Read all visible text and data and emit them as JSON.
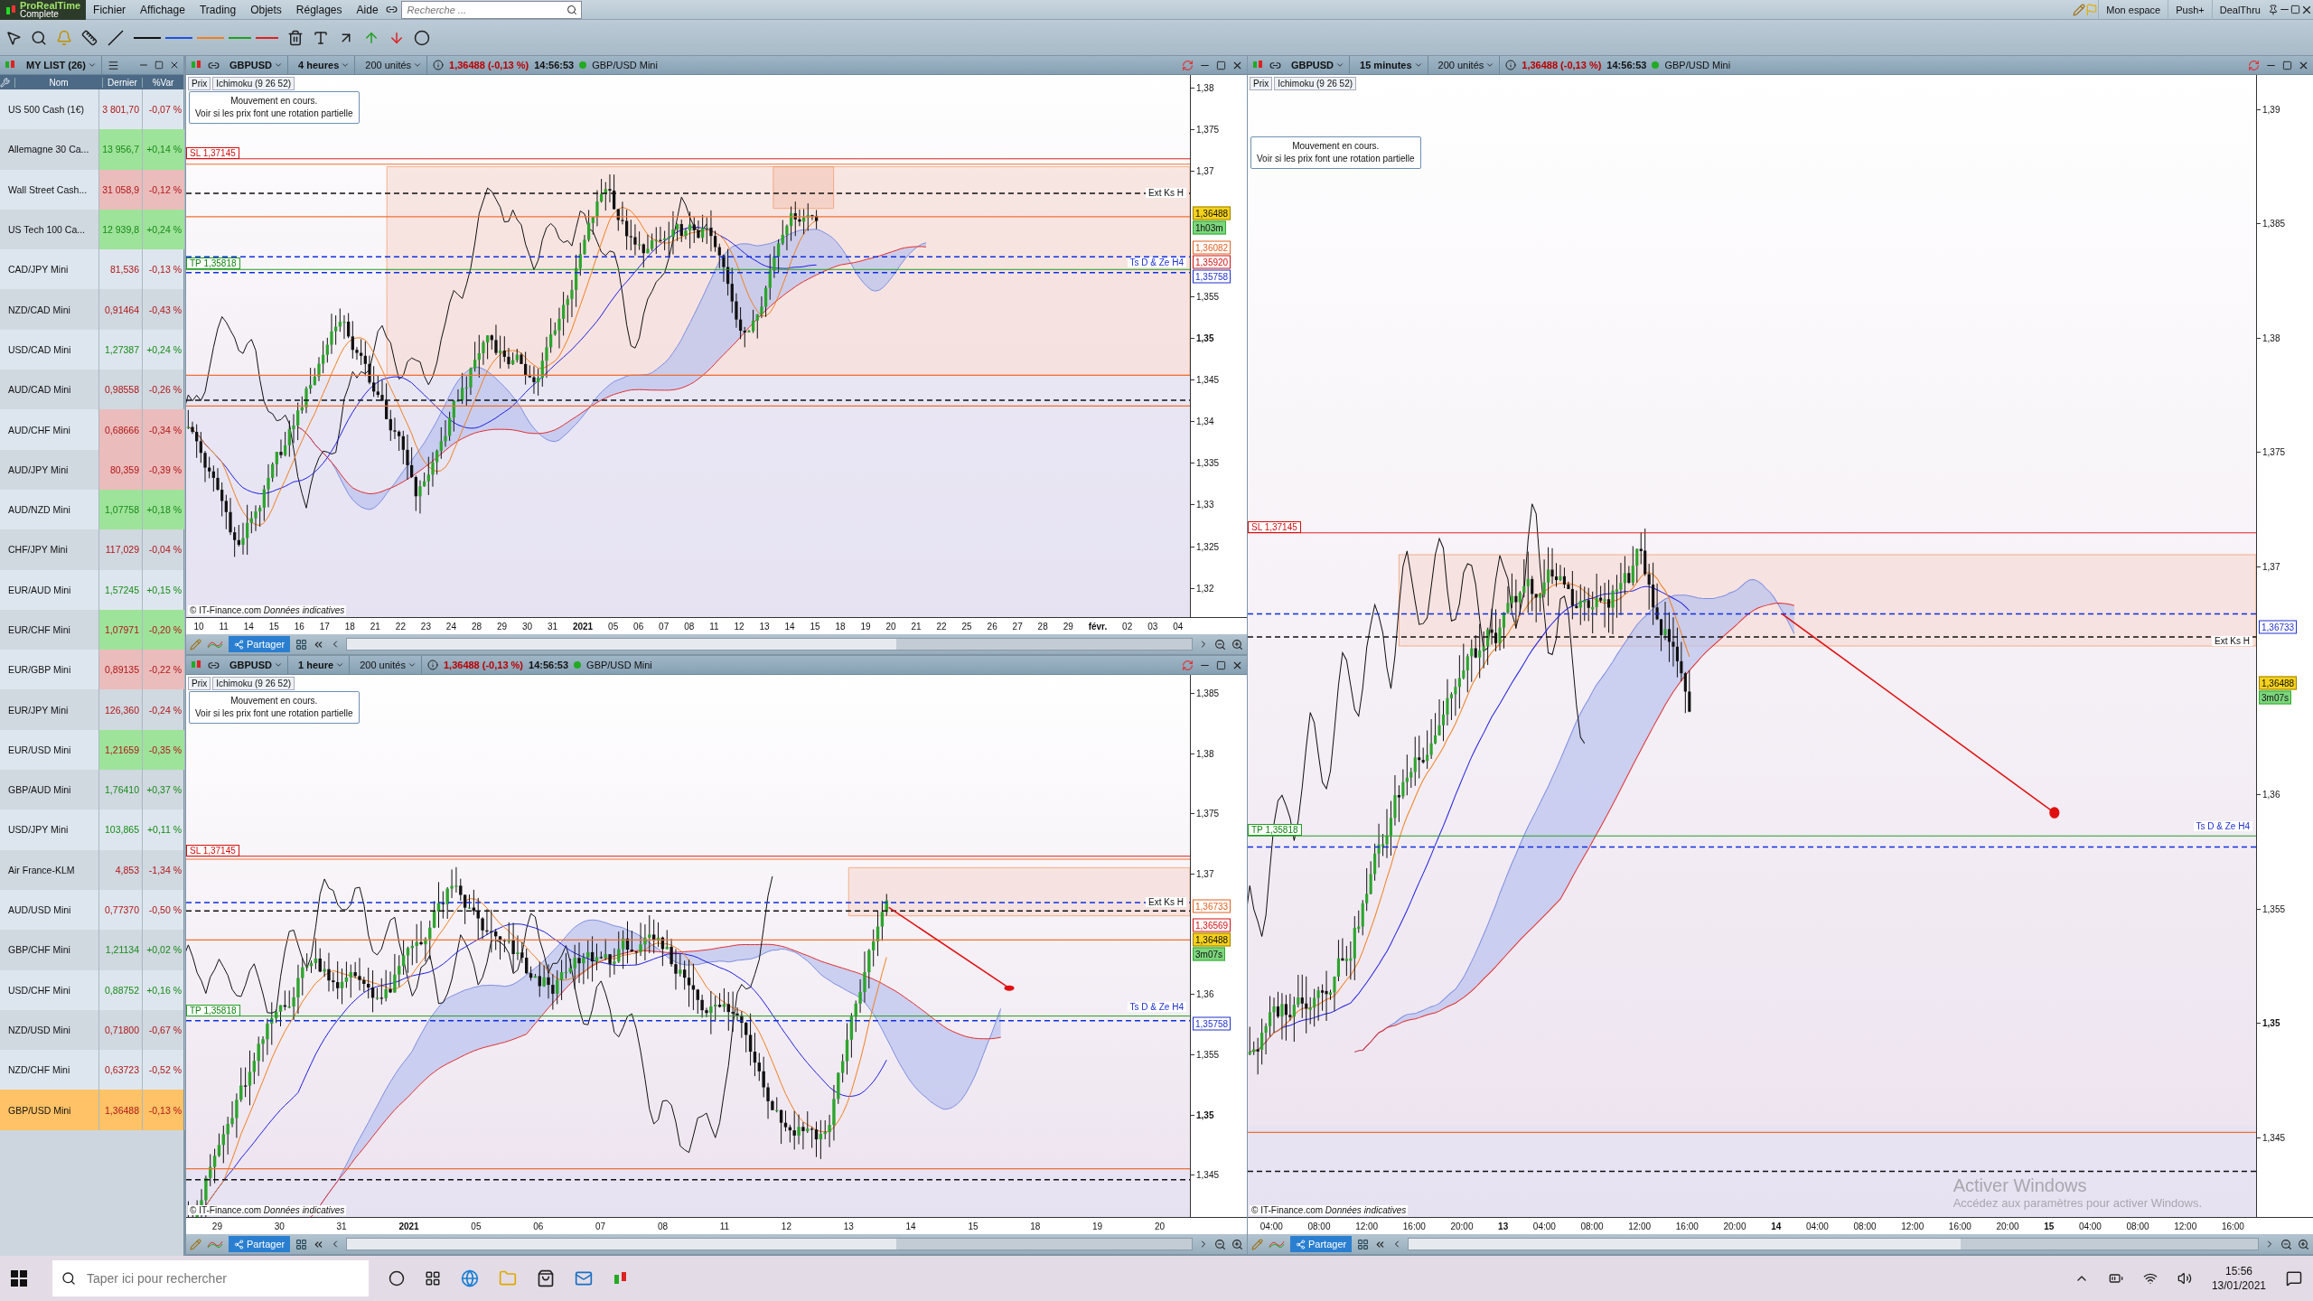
{
  "app": {
    "brand": "ProRealTime",
    "edition": "Complete"
  },
  "menu": [
    "Fichier",
    "Affichage",
    "Trading",
    "Objets",
    "Réglages",
    "Aide"
  ],
  "search": {
    "placeholder": "Recherche ..."
  },
  "top_right": [
    "Mon espace",
    "Push+",
    "DealThru"
  ],
  "watchlist": {
    "title": "MY LIST (26)",
    "columns": [
      "Nom",
      "Dernier",
      "%Var"
    ],
    "rows": [
      {
        "name": "US 500 Cash (1€)",
        "last": "3 801,70",
        "change": "-0,07 %",
        "rising": false,
        "flash_up": false,
        "flash_down": false,
        "selected": false
      },
      {
        "name": "Allemagne 30 Ca...",
        "last": "13 956,7",
        "change": "+0,14 %",
        "rising": true,
        "flash_up": true,
        "flash_down": false,
        "selected": false
      },
      {
        "name": "Wall Street Cash...",
        "last": "31 058,9",
        "change": "-0,12 %",
        "rising": false,
        "flash_up": false,
        "flash_down": true,
        "selected": false
      },
      {
        "name": "US Tech 100 Ca...",
        "last": "12 939,8",
        "change": "+0,24 %",
        "rising": true,
        "flash_up": true,
        "flash_down": false,
        "selected": false
      },
      {
        "name": "CAD/JPY Mini",
        "last": "81,536",
        "change": "-0,13 %",
        "rising": false,
        "flash_up": false,
        "flash_down": false,
        "selected": false
      },
      {
        "name": "NZD/CAD Mini",
        "last": "0,91464",
        "change": "-0,43 %",
        "rising": false,
        "flash_up": false,
        "flash_down": false,
        "selected": false
      },
      {
        "name": "USD/CAD Mini",
        "last": "1,27387",
        "change": "+0,24 %",
        "rising": true,
        "flash_up": false,
        "flash_down": false,
        "selected": false
      },
      {
        "name": "AUD/CAD Mini",
        "last": "0,98558",
        "change": "-0,26 %",
        "rising": false,
        "flash_up": false,
        "flash_down": false,
        "selected": false
      },
      {
        "name": "AUD/CHF Mini",
        "last": "0,68666",
        "change": "-0,34 %",
        "rising": false,
        "flash_up": false,
        "flash_down": true,
        "selected": false
      },
      {
        "name": "AUD/JPY Mini",
        "last": "80,359",
        "change": "-0,39 %",
        "rising": false,
        "flash_up": false,
        "flash_down": true,
        "selected": false
      },
      {
        "name": "AUD/NZD Mini",
        "last": "1,07758",
        "change": "+0,18 %",
        "rising": true,
        "flash_up": true,
        "flash_down": false,
        "selected": false
      },
      {
        "name": "CHF/JPY Mini",
        "last": "117,029",
        "change": "-0,04 %",
        "rising": false,
        "flash_up": false,
        "flash_down": false,
        "selected": false
      },
      {
        "name": "EUR/AUD Mini",
        "last": "1,57245",
        "change": "+0,15 %",
        "rising": true,
        "flash_up": false,
        "flash_down": false,
        "selected": false
      },
      {
        "name": "EUR/CHF Mini",
        "last": "1,07971",
        "change": "-0,20 %",
        "rising": false,
        "flash_up": true,
        "flash_down": false,
        "selected": false
      },
      {
        "name": "EUR/GBP Mini",
        "last": "0,89135",
        "change": "-0,22 %",
        "rising": false,
        "flash_up": false,
        "flash_down": true,
        "selected": false
      },
      {
        "name": "EUR/JPY Mini",
        "last": "126,360",
        "change": "-0,24 %",
        "rising": false,
        "flash_up": false,
        "flash_down": false,
        "selected": false
      },
      {
        "name": "EUR/USD Mini",
        "last": "1,21659",
        "change": "-0,35 %",
        "rising": false,
        "flash_up": true,
        "flash_down": false,
        "selected": false
      },
      {
        "name": "GBP/AUD Mini",
        "last": "1,76410",
        "change": "+0,37 %",
        "rising": true,
        "flash_up": false,
        "flash_down": false,
        "selected": false
      },
      {
        "name": "USD/JPY Mini",
        "last": "103,865",
        "change": "+0,11 %",
        "rising": true,
        "flash_up": false,
        "flash_down": false,
        "selected": false
      },
      {
        "name": "Air France-KLM",
        "last": "4,853",
        "change": "-1,34 %",
        "rising": false,
        "flash_up": false,
        "flash_down": false,
        "selected": false
      },
      {
        "name": "AUD/USD Mini",
        "last": "0,77370",
        "change": "-0,50 %",
        "rising": false,
        "flash_up": false,
        "flash_down": false,
        "selected": false
      },
      {
        "name": "GBP/CHF Mini",
        "last": "1,21134",
        "change": "+0,02 %",
        "rising": true,
        "flash_up": false,
        "flash_down": false,
        "selected": false
      },
      {
        "name": "USD/CHF Mini",
        "last": "0,88752",
        "change": "+0,16 %",
        "rising": true,
        "flash_up": false,
        "flash_down": false,
        "selected": false
      },
      {
        "name": "NZD/USD Mini",
        "last": "0,71800",
        "change": "-0,67 %",
        "rising": false,
        "flash_up": false,
        "flash_down": false,
        "selected": false
      },
      {
        "name": "NZD/CHF Mini",
        "last": "0,63723",
        "change": "-0,52 %",
        "rising": false,
        "flash_up": false,
        "flash_down": false,
        "selected": false
      },
      {
        "name": "GBP/USD Mini",
        "last": "1,36488",
        "change": "-0,13 %",
        "rising": false,
        "flash_up": false,
        "flash_down": false,
        "selected": true
      }
    ]
  },
  "charts": [
    {
      "symbol": "GBPUSD",
      "timeframe": "4 heures",
      "units": "200 unités",
      "price": "1,36488 (-0,13 %)",
      "time": "14:56:53",
      "instrument": "GBP/USD Mini",
      "indicators": [
        "Prix",
        "Ichimoku (9 26 52)"
      ],
      "note": [
        "Mouvement en cours.",
        "Voir si les prix font une rotation partielle"
      ],
      "sl": "SL 1,37145",
      "tp": "TP 1,35818",
      "line_labels": [
        "Ext Ks H",
        "Ts D & Ze H4"
      ],
      "yticks": [
        {
          "label": "1,38",
          "bold": false
        },
        {
          "label": "1,375",
          "bold": false
        },
        {
          "label": "1,37",
          "bold": false
        },
        {
          "label": "1,355",
          "bold": false
        },
        {
          "label": "1,35",
          "bold": true
        },
        {
          "label": "1,345",
          "bold": false
        },
        {
          "label": "1,34",
          "bold": false
        },
        {
          "label": "1,335",
          "bold": false
        },
        {
          "label": "1,33",
          "bold": false
        },
        {
          "label": "1,325",
          "bold": false
        },
        {
          "label": "1,32",
          "bold": false
        }
      ],
      "price_tags": [
        {
          "text": "1,36488",
          "kind": "last"
        },
        {
          "text": "1h03m",
          "kind": "timer"
        },
        {
          "text": "1,36082",
          "kind": "orange"
        },
        {
          "text": "1,35920",
          "kind": "red"
        },
        {
          "text": "1,35758",
          "kind": "blue"
        }
      ],
      "xticks": [
        {
          "label": "10",
          "bold": false
        },
        {
          "label": "11",
          "bold": false
        },
        {
          "label": "14",
          "bold": false
        },
        {
          "label": "15",
          "bold": false
        },
        {
          "label": "16",
          "bold": false
        },
        {
          "label": "17",
          "bold": false
        },
        {
          "label": "18",
          "bold": false
        },
        {
          "label": "21",
          "bold": false
        },
        {
          "label": "22",
          "bold": false
        },
        {
          "label": "23",
          "bold": false
        },
        {
          "label": "24",
          "bold": false
        },
        {
          "label": "28",
          "bold": false
        },
        {
          "label": "29",
          "bold": false
        },
        {
          "label": "30",
          "bold": false
        },
        {
          "label": "31",
          "bold": false
        },
        {
          "label": "2021",
          "bold": true
        },
        {
          "label": "05",
          "bold": false
        },
        {
          "label": "06",
          "bold": false
        },
        {
          "label": "07",
          "bold": false
        },
        {
          "label": "08",
          "bold": false
        },
        {
          "label": "11",
          "bold": false
        },
        {
          "label": "12",
          "bold": false
        },
        {
          "label": "13",
          "bold": false
        },
        {
          "label": "14",
          "bold": false
        },
        {
          "label": "15",
          "bold": false
        },
        {
          "label": "18",
          "bold": false
        },
        {
          "label": "19",
          "bold": false
        },
        {
          "label": "20",
          "bold": false
        },
        {
          "label": "21",
          "bold": false
        },
        {
          "label": "22",
          "bold": false
        },
        {
          "label": "25",
          "bold": false
        },
        {
          "label": "26",
          "bold": false
        },
        {
          "label": "27",
          "bold": false
        },
        {
          "label": "28",
          "bold": false
        },
        {
          "label": "29",
          "bold": false
        },
        {
          "label": "févr.",
          "bold": true
        },
        {
          "label": "02",
          "bold": false
        },
        {
          "label": "03",
          "bold": false
        },
        {
          "label": "04",
          "bold": false
        }
      ],
      "credit": "© IT-Finance.com",
      "credit_note": "Données indicatives",
      "share": "Partager"
    },
    {
      "symbol": "GBPUSD",
      "timeframe": "1 heure",
      "units": "200 unités",
      "price": "1,36488 (-0,13 %)",
      "time": "14:56:53",
      "instrument": "GBP/USD Mini",
      "indicators": [
        "Prix",
        "Ichimoku (9 26 52)"
      ],
      "note": [
        "Mouvement en cours.",
        "Voir si les prix font une rotation partielle"
      ],
      "sl": "SL 1,37145",
      "tp": "TP 1,35818",
      "line_labels": [
        "Ext Ks H",
        "Ts D & Ze H4"
      ],
      "yticks": [
        {
          "label": "1,385",
          "bold": false
        },
        {
          "label": "1,38",
          "bold": false
        },
        {
          "label": "1,375",
          "bold": false
        },
        {
          "label": "1,37",
          "bold": false
        },
        {
          "label": "1,36",
          "bold": false
        },
        {
          "label": "1,355",
          "bold": false
        },
        {
          "label": "1,35",
          "bold": true
        },
        {
          "label": "1,345",
          "bold": false
        }
      ],
      "price_tags": [
        {
          "text": "1,36733",
          "kind": "orange"
        },
        {
          "text": "1,36569",
          "kind": "red"
        },
        {
          "text": "1,36488",
          "kind": "last"
        },
        {
          "text": "3m07s",
          "kind": "timer"
        },
        {
          "text": "1,35758",
          "kind": "blue"
        }
      ],
      "xticks": [
        {
          "label": "29",
          "bold": false
        },
        {
          "label": "30",
          "bold": false
        },
        {
          "label": "31",
          "bold": false
        },
        {
          "label": "2021",
          "bold": true
        },
        {
          "label": "05",
          "bold": false
        },
        {
          "label": "06",
          "bold": false
        },
        {
          "label": "07",
          "bold": false
        },
        {
          "label": "08",
          "bold": false
        },
        {
          "label": "11",
          "bold": false
        },
        {
          "label": "12",
          "bold": false
        },
        {
          "label": "13",
          "bold": false
        },
        {
          "label": "14",
          "bold": false
        },
        {
          "label": "15",
          "bold": false
        },
        {
          "label": "18",
          "bold": false
        },
        {
          "label": "19",
          "bold": false
        },
        {
          "label": "20",
          "bold": false
        }
      ],
      "credit": "© IT-Finance.com",
      "credit_note": "Données indicatives",
      "share": "Partager"
    },
    {
      "symbol": "GBPUSD",
      "timeframe": "15 minutes",
      "units": "200 unités",
      "price": "1,36488 (-0,13 %)",
      "time": "14:56:53",
      "instrument": "GBP/USD Mini",
      "indicators": [
        "Prix",
        "Ichimoku (9 26 52)"
      ],
      "note": [
        "Mouvement en cours.",
        "Voir si les prix font une rotation partielle"
      ],
      "sl": "SL 1,37145",
      "tp": "TP 1,35818",
      "line_labels": [
        "Ext Ks H",
        "Ts D & Ze H4"
      ],
      "yticks": [
        {
          "label": "1,39",
          "bold": false
        },
        {
          "label": "1,385",
          "bold": false
        },
        {
          "label": "1,38",
          "bold": false
        },
        {
          "label": "1,375",
          "bold": false
        },
        {
          "label": "1,37",
          "bold": false
        },
        {
          "label": "1,36",
          "bold": false
        },
        {
          "label": "1,355",
          "bold": false
        },
        {
          "label": "1,35",
          "bold": true
        },
        {
          "label": "1,345",
          "bold": false
        }
      ],
      "price_tags": [
        {
          "text": "1,36733",
          "kind": "blue"
        },
        {
          "text": "1,36488",
          "kind": "last"
        },
        {
          "text": "3m07s",
          "kind": "timer"
        }
      ],
      "xticks": [
        {
          "label": "04:00",
          "bold": false
        },
        {
          "label": "08:00",
          "bold": false
        },
        {
          "label": "12:00",
          "bold": false
        },
        {
          "label": "16:00",
          "bold": false
        },
        {
          "label": "20:00",
          "bold": false
        },
        {
          "label": "13",
          "bold": true
        },
        {
          "label": "04:00",
          "bold": false
        },
        {
          "label": "08:00",
          "bold": false
        },
        {
          "label": "12:00",
          "bold": false
        },
        {
          "label": "16:00",
          "bold": false
        },
        {
          "label": "20:00",
          "bold": false
        },
        {
          "label": "14",
          "bold": true
        },
        {
          "label": "04:00",
          "bold": false
        },
        {
          "label": "08:00",
          "bold": false
        },
        {
          "label": "12:00",
          "bold": false
        },
        {
          "label": "16:00",
          "bold": false
        },
        {
          "label": "20:00",
          "bold": false
        },
        {
          "label": "15",
          "bold": true
        },
        {
          "label": "04:00",
          "bold": false
        },
        {
          "label": "08:00",
          "bold": false
        },
        {
          "label": "12:00",
          "bold": false
        },
        {
          "label": "16:00",
          "bold": false
        }
      ],
      "credit": "© IT-Finance.com",
      "credit_note": "Données indicatives",
      "share": "Partager"
    }
  ],
  "activation": {
    "title": "Activer Windows",
    "text": "Accédez aux paramètres pour activer Windows."
  },
  "taskbar": {
    "search_placeholder": "Taper ici pour rechercher",
    "time": "15:56",
    "date": "13/01/2021"
  }
}
